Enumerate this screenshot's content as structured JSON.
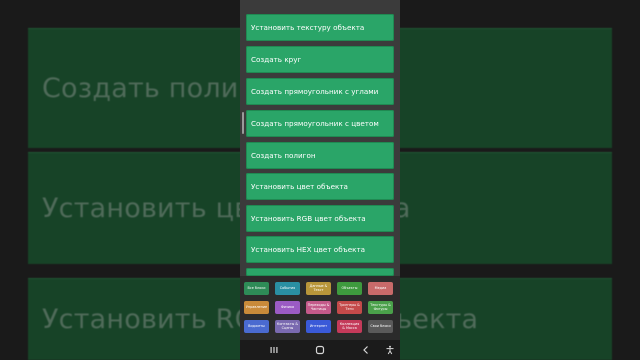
{
  "background": {
    "labels": [
      "Создать полигон",
      "Установить цвет объекта",
      "Установить RGB цвет объекта"
    ]
  },
  "blocks": [
    {
      "label": "Установить текстуру объекта"
    },
    {
      "label": "Создать круг"
    },
    {
      "label": "Создать прямоугольник с углами"
    },
    {
      "label": "Создать прямоугольник с цветом"
    },
    {
      "label": "Создать полигон"
    },
    {
      "label": "Установить цвет объекта"
    },
    {
      "label": "Установить RGB цвет объекта"
    },
    {
      "label": "Установить HEX цвет объекта"
    }
  ],
  "categories": [
    {
      "label": "Все блоки",
      "color": "#2e8b57"
    },
    {
      "label": "События",
      "color": "#2a8fa3"
    },
    {
      "label": "Данные & Текст",
      "color": "#b8963a"
    },
    {
      "label": "Объекты",
      "color": "#3e9a3e"
    },
    {
      "label": "Медиа",
      "color": "#c86a6a"
    },
    {
      "label": "Управление",
      "color": "#c98a3a"
    },
    {
      "label": "Физика",
      "color": "#9b5bc4"
    },
    {
      "label": "Переходы & Частицы",
      "color": "#c45a8a"
    },
    {
      "label": "Триггеры & Теги",
      "color": "#c44a4a"
    },
    {
      "label": "Текстуры & Фигуры",
      "color": "#4aa04a"
    },
    {
      "label": "Виджеты",
      "color": "#4a6ad0"
    },
    {
      "label": "Контакты & Сцены",
      "color": "#7a6ab0"
    },
    {
      "label": "Интернет",
      "color": "#3a5ad8"
    },
    {
      "label": "Коллекция & Масса",
      "color": "#c43a5a"
    },
    {
      "label": "Свои блоки",
      "color": "#5a5a5a"
    }
  ],
  "navbar": {
    "recents_icon": "recents-icon",
    "home_icon": "home-icon",
    "back_icon": "back-icon",
    "accessibility_icon": "accessibility-icon"
  }
}
